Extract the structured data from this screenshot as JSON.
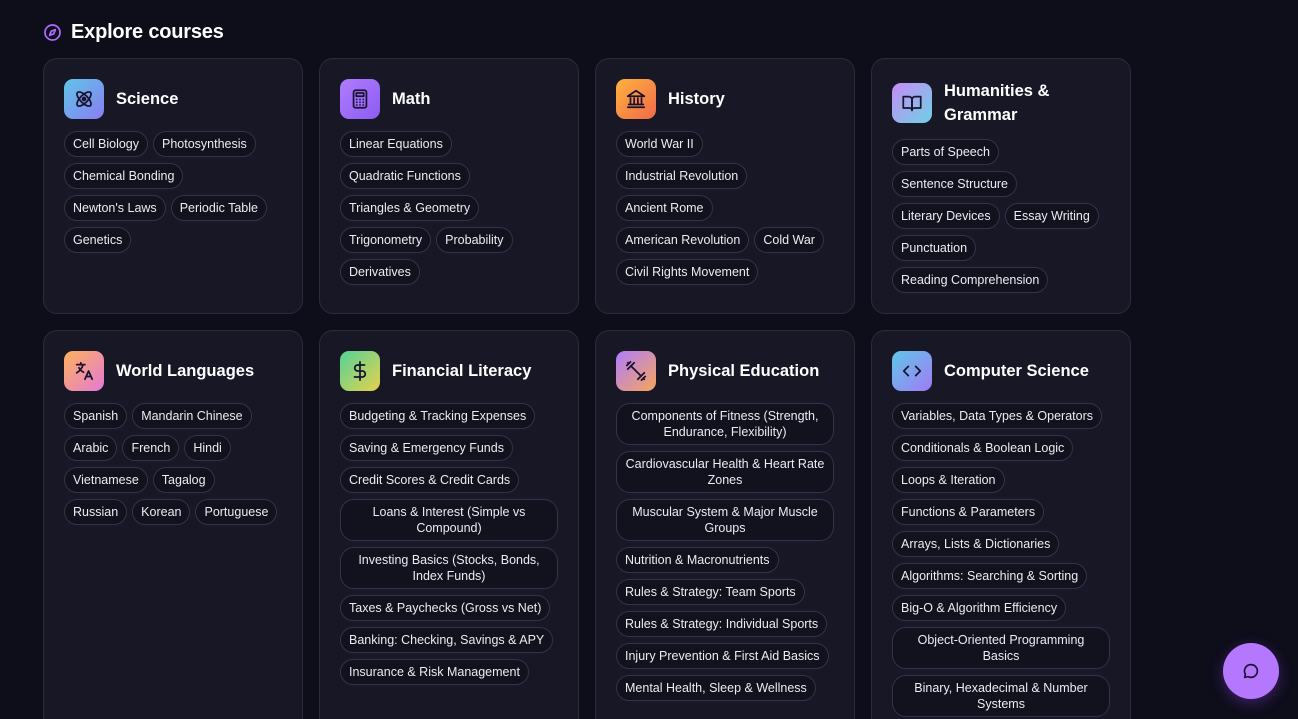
{
  "header": {
    "title": "Explore courses",
    "icon": "compass-icon",
    "accent": "#b06cff"
  },
  "courses": [
    {
      "id": "science",
      "title": "Science",
      "icon": "atom-icon",
      "gradient": [
        "#5fc6e8",
        "#8a7cf2"
      ],
      "topics": [
        "Cell Biology",
        "Photosynthesis",
        "Chemical Bonding",
        "Newton's Laws",
        "Periodic Table",
        "Genetics"
      ]
    },
    {
      "id": "math",
      "title": "Math",
      "icon": "calculator-icon",
      "gradient": [
        "#b07cff",
        "#8c5cf0"
      ],
      "topics": [
        "Linear Equations",
        "Quadratic Functions",
        "Triangles & Geometry",
        "Trigonometry",
        "Probability",
        "Derivatives"
      ]
    },
    {
      "id": "history",
      "title": "History",
      "icon": "landmark-icon",
      "gradient": [
        "#ffb23e",
        "#f06a4a"
      ],
      "topics": [
        "World War II",
        "Industrial Revolution",
        "Ancient Rome",
        "American Revolution",
        "Cold War",
        "Civil Rights Movement"
      ]
    },
    {
      "id": "humanities",
      "title": "Humanities & Grammar",
      "icon": "book-open-icon",
      "gradient": [
        "#c58cf5",
        "#6fd0e6"
      ],
      "topics": [
        "Parts of Speech",
        "Sentence Structure",
        "Literary Devices",
        "Essay Writing",
        "Punctuation",
        "Reading Comprehension"
      ]
    },
    {
      "id": "languages",
      "title": "World Languages",
      "icon": "translate-icon",
      "gradient": [
        "#ffb15c",
        "#e27ad6"
      ],
      "topics": [
        "Spanish",
        "Mandarin Chinese",
        "Arabic",
        "French",
        "Hindi",
        "Vietnamese",
        "Tagalog",
        "Russian",
        "Korean",
        "Portuguese"
      ]
    },
    {
      "id": "finance",
      "title": "Financial Literacy",
      "icon": "dollar-icon",
      "gradient": [
        "#52d39a",
        "#e8d14a"
      ],
      "topics": [
        "Budgeting & Tracking Expenses",
        "Saving & Emergency Funds",
        "Credit Scores & Credit Cards",
        "Loans & Interest (Simple vs Compound)",
        "Investing Basics (Stocks, Bonds, Index Funds)",
        "Taxes & Paychecks (Gross vs Net)",
        "Banking: Checking, Savings & APY",
        "Insurance & Risk Management"
      ]
    },
    {
      "id": "pe",
      "title": "Physical Education",
      "icon": "dumbbell-icon",
      "gradient": [
        "#b07cff",
        "#f5a65a"
      ],
      "topics": [
        "Components of Fitness (Strength, Endurance, Flexibility)",
        "Cardiovascular Health & Heart Rate Zones",
        "Muscular System & Major Muscle Groups",
        "Nutrition & Macronutrients",
        "Rules & Strategy: Team Sports",
        "Rules & Strategy: Individual Sports",
        "Injury Prevention & First Aid Basics",
        "Mental Health, Sleep & Wellness"
      ]
    },
    {
      "id": "cs",
      "title": "Computer Science",
      "icon": "code-icon",
      "gradient": [
        "#5fc6e8",
        "#a07cf5"
      ],
      "topics": [
        "Variables, Data Types & Operators",
        "Conditionals & Boolean Logic",
        "Loops & Iteration",
        "Functions & Parameters",
        "Arrays, Lists & Dictionaries",
        "Algorithms: Searching & Sorting",
        "Big-O & Algorithm Efficiency",
        "Object-Oriented Programming Basics",
        "Binary, Hexadecimal & Number Systems"
      ]
    }
  ],
  "chat_button": {
    "icon": "chat-bubble-icon",
    "color": "#b677ff"
  }
}
